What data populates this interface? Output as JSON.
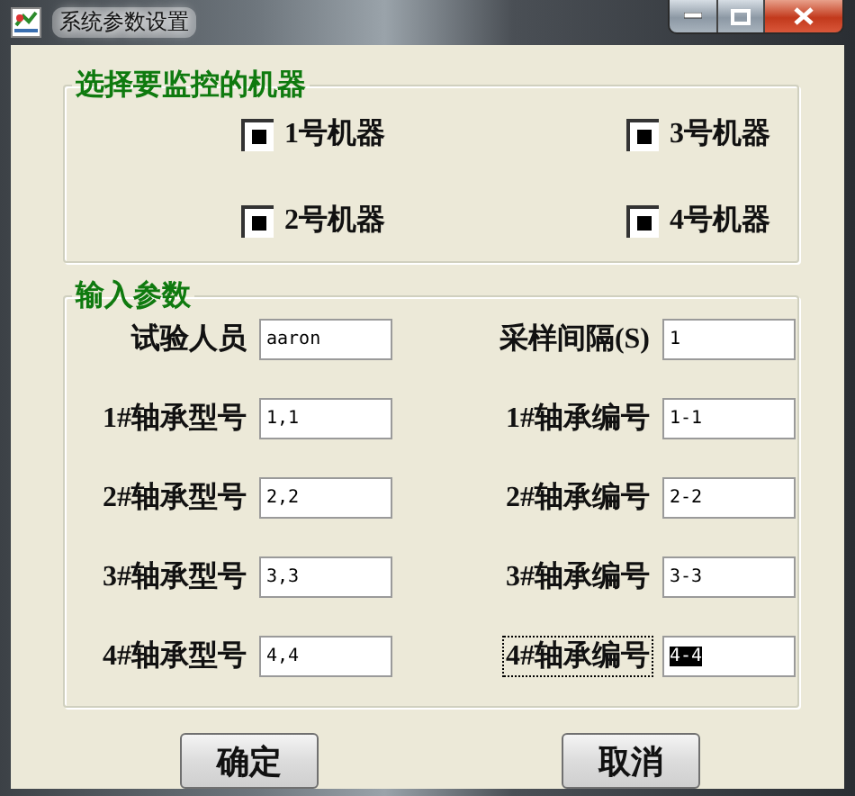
{
  "window": {
    "title": "系统参数设置"
  },
  "machines": {
    "title": "选择要监控的机器",
    "items": [
      {
        "label": "1号机器",
        "checked": true
      },
      {
        "label": "3号机器",
        "checked": true
      },
      {
        "label": "2号机器",
        "checked": true
      },
      {
        "label": "4号机器",
        "checked": true
      }
    ]
  },
  "params": {
    "title": "输入参数",
    "fields": [
      {
        "label": "试验人员",
        "value": "aaron",
        "focused": false
      },
      {
        "label": "采样间隔(S)",
        "value": "1",
        "focused": false
      },
      {
        "label": "1#轴承型号",
        "value": "1,1",
        "focused": false
      },
      {
        "label": "1#轴承编号",
        "value": "1-1",
        "focused": false
      },
      {
        "label": "2#轴承型号",
        "value": "2,2",
        "focused": false
      },
      {
        "label": "2#轴承编号",
        "value": "2-2",
        "focused": false
      },
      {
        "label": "3#轴承型号",
        "value": "3,3",
        "focused": false
      },
      {
        "label": "3#轴承编号",
        "value": "3-3",
        "focused": false
      },
      {
        "label": "4#轴承型号",
        "value": "4,4",
        "focused": false
      },
      {
        "label": "4#轴承编号",
        "value": "4-4",
        "focused": true
      }
    ]
  },
  "buttons": [
    "确定",
    "取消"
  ]
}
